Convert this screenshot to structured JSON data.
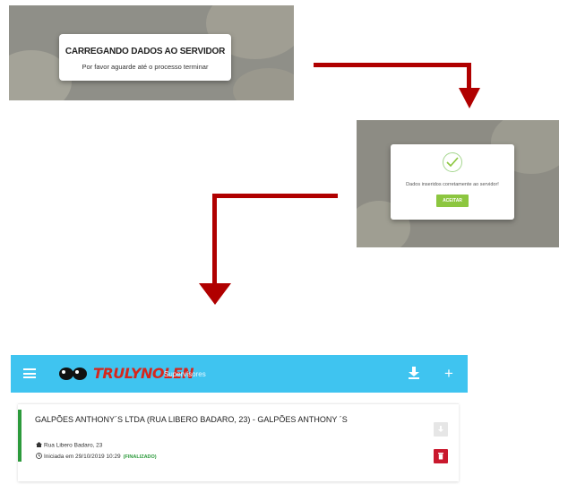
{
  "loading_dialog": {
    "title": "CARREGANDO DADOS AO SERVIDOR",
    "message": "Por favor aguarde até o processo terminar"
  },
  "success_dialog": {
    "icon": "check-icon",
    "message": "Dados inseridos corretamente ao servidor!",
    "accept_label": "ACEITAR"
  },
  "app": {
    "header_color": "#3fc4f0",
    "logo_text": "TRULYNOLEN",
    "subtitle": "Supervisores",
    "icons": [
      "menu-icon",
      "download-icon",
      "plus-icon"
    ],
    "plus_label": "+"
  },
  "card": {
    "title": "GALPÕES ANTHONY´S LTDA (RUA LIBERO BADARO, 23) - GALPÕES ANTHONY ´S",
    "address": "Rua Libero Badaro, 23",
    "started": "Iniciada em 29/10/2019 10:29",
    "status": "(FINALIZADO)",
    "status_color": "#2c9a3b"
  },
  "colors": {
    "arrow": "#b00000",
    "accept_button": "#8cc63f",
    "delete_button": "#c9182d"
  }
}
